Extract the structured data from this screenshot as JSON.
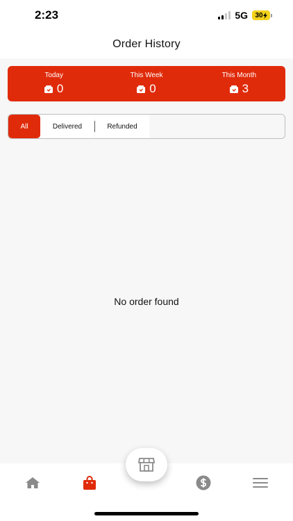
{
  "status_bar": {
    "time": "2:23",
    "network": "5G",
    "battery": "30"
  },
  "header": {
    "title": "Order History"
  },
  "summary": {
    "items": [
      {
        "label": "Today",
        "value": "0"
      },
      {
        "label": "This Week",
        "value": "0"
      },
      {
        "label": "This Month",
        "value": "3"
      }
    ]
  },
  "tabs": [
    {
      "label": "All",
      "active": true
    },
    {
      "label": "Delivered",
      "active": false
    },
    {
      "label": "Refunded",
      "active": false
    }
  ],
  "empty_state": {
    "message": "No order found"
  },
  "bottom_nav": {
    "items": [
      {
        "icon": "home-icon",
        "active": false
      },
      {
        "icon": "shopping-bag-icon",
        "active": true
      },
      {
        "icon": "store-icon",
        "active": false
      },
      {
        "icon": "dollar-icon",
        "active": false
      },
      {
        "icon": "menu-icon",
        "active": false
      }
    ]
  },
  "colors": {
    "accent": "#e02b0b",
    "background": "#f7f7f7",
    "icon_inactive": "#8a8a8a"
  }
}
